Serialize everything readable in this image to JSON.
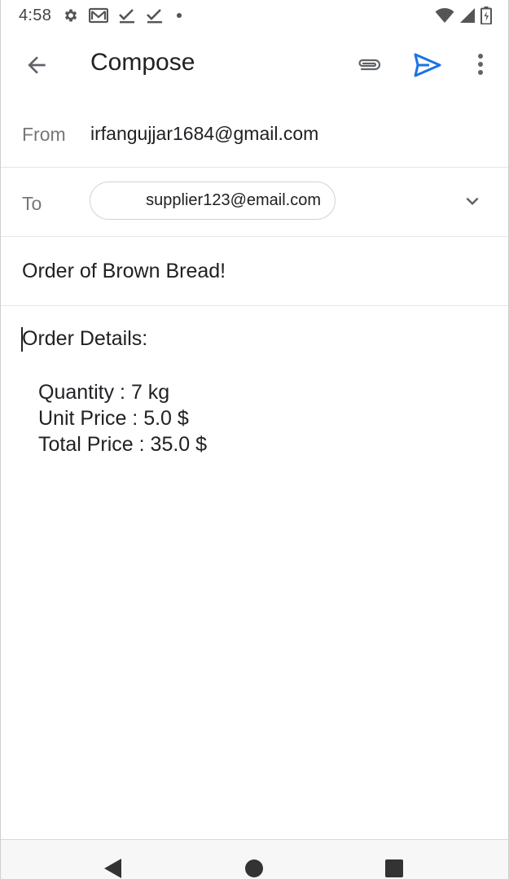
{
  "status_bar": {
    "time": "4:58",
    "icons_left": [
      "gear-icon",
      "gmail-icon",
      "check-icon",
      "check-icon",
      "dot-icon"
    ],
    "icons_right": [
      "wifi-icon",
      "signal-icon",
      "battery-icon"
    ]
  },
  "app_bar": {
    "title": "Compose",
    "back_icon": "arrow-left-icon",
    "attach_icon": "paperclip-icon",
    "send_icon": "send-icon",
    "more_icon": "more-vertical-icon"
  },
  "compose": {
    "from_label": "From",
    "from_value": "irfangujjar1684@gmail.com",
    "to_label": "To",
    "to_recipient": "supplier123@email.com",
    "subject": "Order of Brown Bread!",
    "body_heading": "Order Details:",
    "body_lines": [
      "Quantity : 7 kg",
      "Unit Price : 5.0 $",
      "Total Price : 35.0 $"
    ]
  },
  "colors": {
    "accent": "#1a73e8",
    "text": "#202124",
    "label": "#777777",
    "divider": "#e6e6e6"
  }
}
